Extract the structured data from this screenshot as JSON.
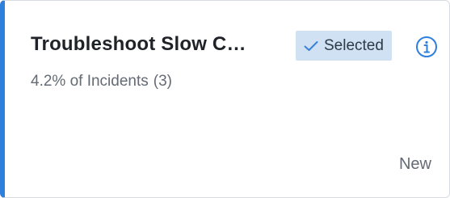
{
  "card": {
    "title": "Troubleshoot Slow C…",
    "percentage": "4.2% of Incidents",
    "count": "(3)",
    "badge": {
      "label": "Selected",
      "icon": "checkmark-icon"
    },
    "info_icon": "info-icon",
    "status": "New"
  },
  "colors": {
    "accent": "#2f7fdc",
    "badge_background": "#cfe1f3",
    "title_text": "#1f2328",
    "secondary_text": "#646b74"
  }
}
